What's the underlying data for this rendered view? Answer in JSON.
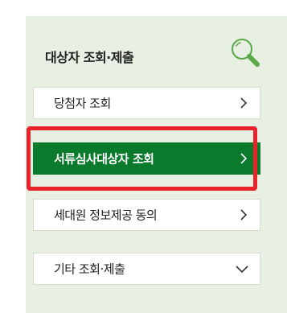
{
  "panel": {
    "title": "대상자 조회·제출",
    "search_icon": "search-icon"
  },
  "menu": {
    "items": [
      {
        "label": "당첨자 조회",
        "icon": "chevron-right-icon"
      },
      {
        "label": "서류심사대상자 조회",
        "icon": "chevron-right-icon",
        "active": true
      },
      {
        "label": "세대원 정보제공 동의",
        "icon": "chevron-right-icon"
      },
      {
        "label": "기타 조회·제출",
        "icon": "chevron-down-icon"
      }
    ]
  },
  "colors": {
    "panel_bg": "#e8efe3",
    "active_bg": "#0a7a2c",
    "highlight_border": "#e8232a",
    "icon_green": "#5aa84a"
  }
}
